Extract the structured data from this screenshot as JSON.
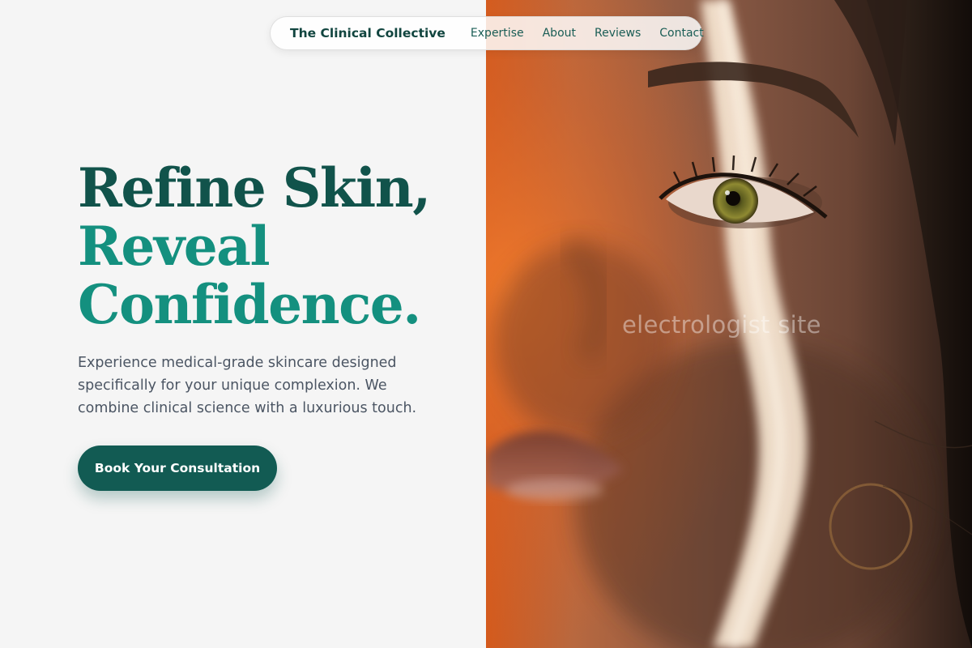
{
  "nav": {
    "brand": "The Clinical Collective",
    "links": [
      "Expertise",
      "About",
      "Reviews",
      "Contact"
    ]
  },
  "hero": {
    "title_lines": [
      "Refine Skin,",
      "Reveal",
      "Confidence."
    ],
    "description": "Experience medical-grade skincare designed specifically for your unique complexion. We combine clinical science with a luxurious touch.",
    "cta_label": "Book Your Consultation"
  },
  "image": {
    "subject": "close-up of a woman's face with a band of warm sunlight across it",
    "watermark": "electrologist site"
  },
  "colors": {
    "background": "#f5f5f5",
    "brand_dark": "#11534b",
    "brand_accent": "#14907f",
    "button": "#125b53",
    "body_text": "#4b5563"
  }
}
